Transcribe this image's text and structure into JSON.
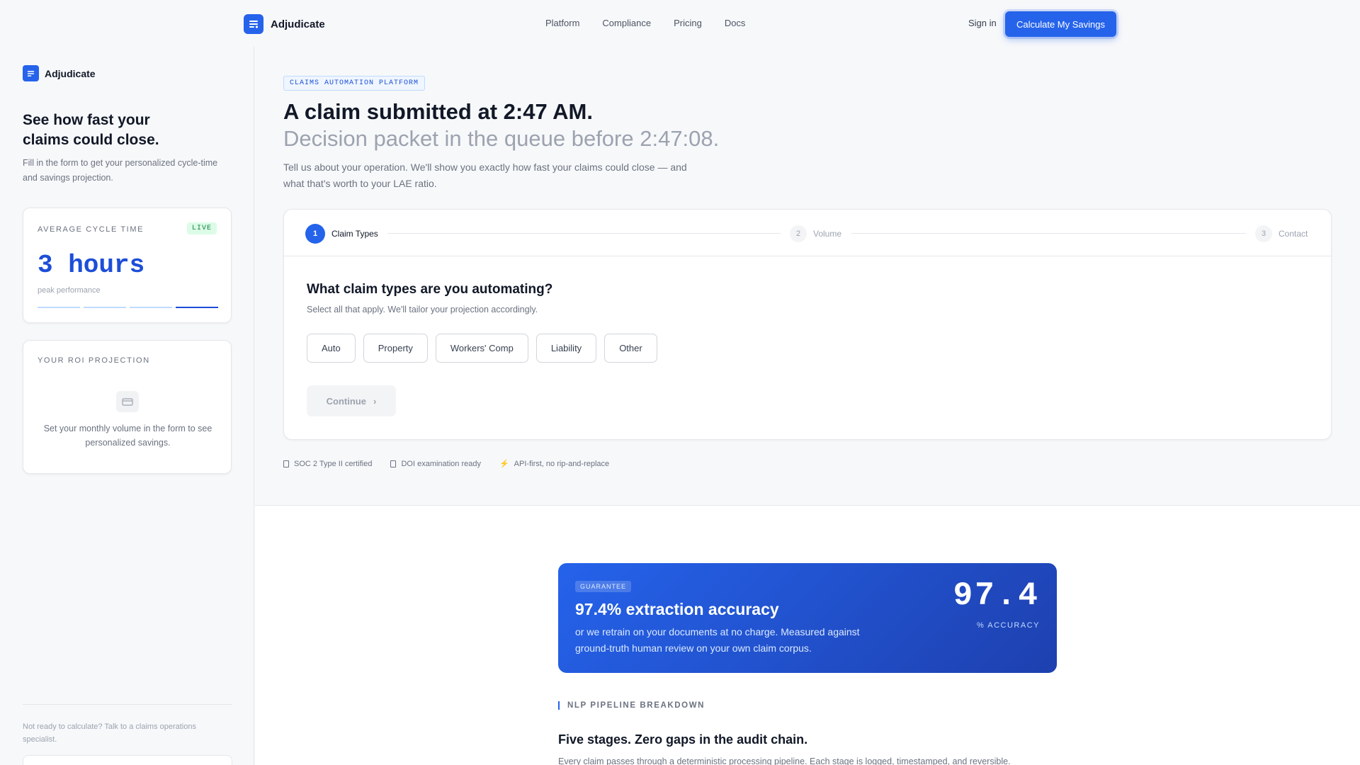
{
  "nav": {
    "brand": "Adjudicate",
    "links": [
      "Platform",
      "Compliance",
      "Pricing",
      "Docs"
    ],
    "signin": "Sign in",
    "cta": "Calculate My Savings"
  },
  "sidebar": {
    "brand": "Adjudicate",
    "title": "See how fast your claims could close.",
    "subtitle": "Fill in the form to get your personalized cycle-time and savings projection.",
    "cycle_card": {
      "label": "AVERAGE CYCLE TIME",
      "badge": "LIVE",
      "value": "3 hours",
      "note": "peak performance",
      "progress_segments_total": 4,
      "progress_segment_active": 4
    },
    "roi_card": {
      "label": "YOUR ROI PROJECTION",
      "icon": "wallet-icon",
      "text": "Set your monthly volume in the form to see personalized savings."
    },
    "footer": "Not ready to calculate? Talk to a claims operations specialist."
  },
  "hero": {
    "badge": "CLAIMS AUTOMATION PLATFORM",
    "headline": "A claim submitted at 2:47 AM.",
    "subheadline": "Decision packet in the queue before 2:47:08.",
    "lede": "Tell us about your operation. We'll show you exactly how fast your claims could close — and what that's worth to your LAE ratio."
  },
  "form": {
    "steps": [
      {
        "num": "1",
        "label": "Claim Types"
      },
      {
        "num": "2",
        "label": "Volume"
      },
      {
        "num": "3",
        "label": "Contact"
      }
    ],
    "question": "What claim types are you automating?",
    "hint": "Select all that apply. We'll tailor your projection accordingly.",
    "options": [
      "Auto",
      "Property",
      "Workers' Comp",
      "Liability",
      "Other"
    ],
    "continue": "Continue",
    "continue_icon": "›"
  },
  "trust": [
    {
      "icon": "document-icon",
      "glyph": "",
      "text": "SOC 2 Type II certified"
    },
    {
      "icon": "document-icon",
      "glyph": "",
      "text": "DOI examination ready"
    },
    {
      "icon": "lightning-icon",
      "glyph": "⚡",
      "text": "API-first, no rip-and-replace"
    }
  ],
  "guarantee": {
    "badge": "GUARANTEE",
    "title": "97.4% extraction accuracy",
    "text": "or we retrain on your documents at no charge. Measured against ground-truth human review on your own claim corpus.",
    "number": "97.4",
    "unit": "% ACCURACY",
    "colors": {
      "from": "#2563eb",
      "to": "#1e40af"
    }
  },
  "pipeline": {
    "label": "NLP PIPELINE BREAKDOWN",
    "title": "Five stages. Zero gaps in the audit chain.",
    "text": "Every claim passes through a deterministic processing pipeline. Each stage is logged, timestamped, and reversible."
  },
  "colors": {
    "accent": "#2563eb",
    "live": "#15803d"
  }
}
